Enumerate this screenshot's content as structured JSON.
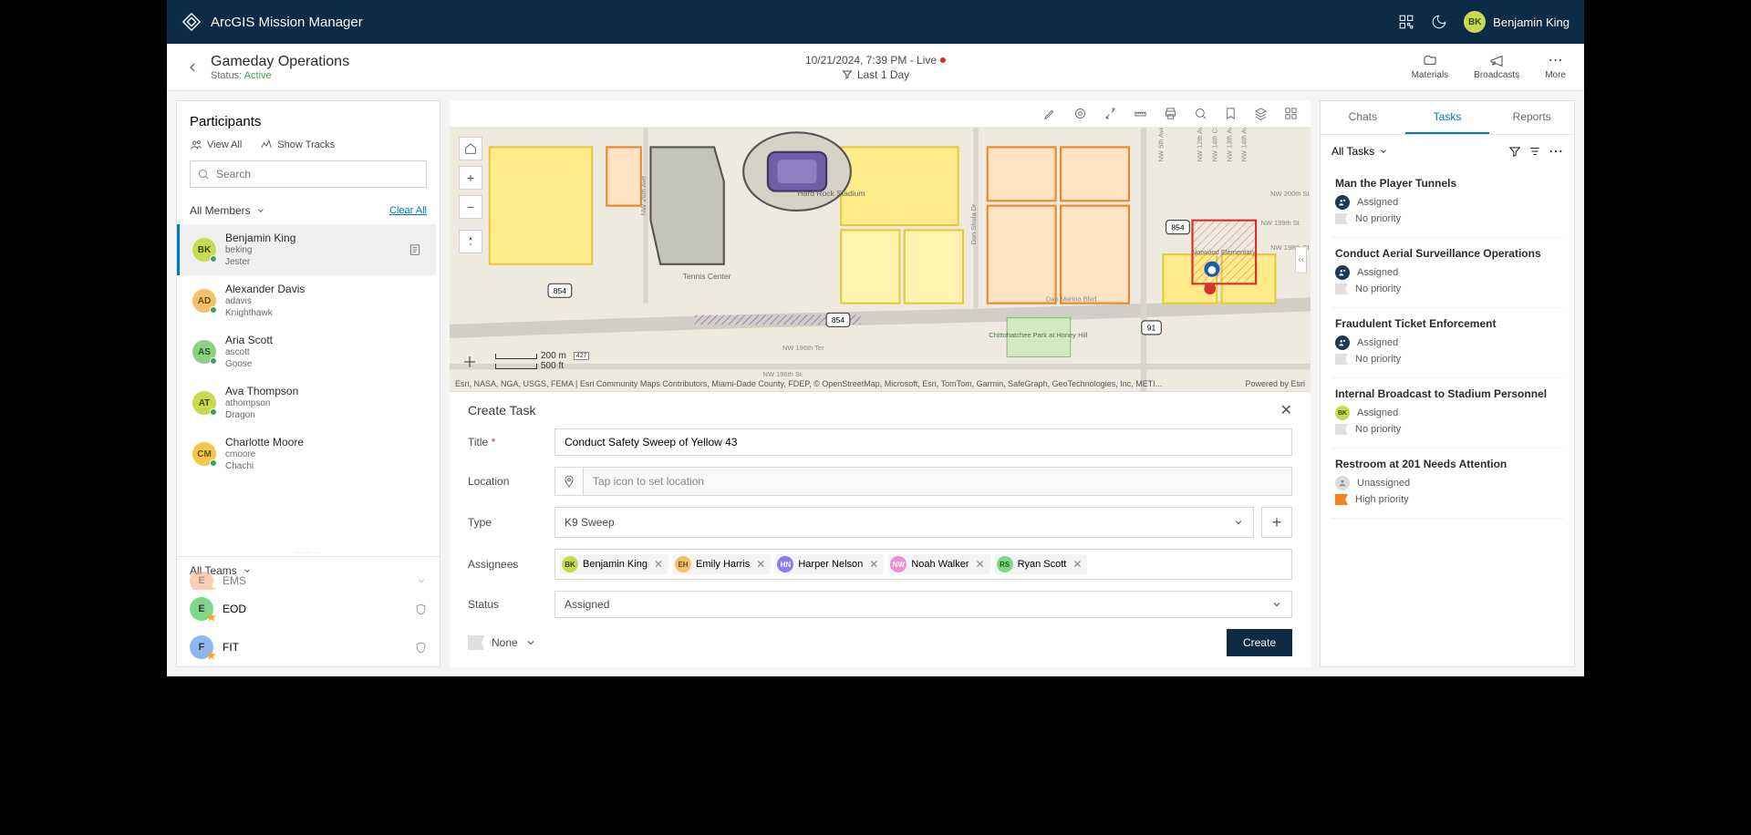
{
  "topbar": {
    "app_title": "ArcGIS Mission Manager",
    "user_initials": "BK",
    "user_name": "Benjamin King"
  },
  "subheader": {
    "mission_title": "Gameday Operations",
    "status_label": "Status:",
    "status_value": "Active",
    "datetime": "10/21/2024, 7:39 PM - Live",
    "time_filter": "Last 1 Day",
    "actions": {
      "materials": "Materials",
      "broadcasts": "Broadcasts",
      "more": "More"
    }
  },
  "participants": {
    "title": "Participants",
    "view_all": "View All",
    "show_tracks": "Show Tracks",
    "search_placeholder": "Search",
    "all_members_label": "All Members",
    "clear_all": "Clear All",
    "members": [
      {
        "initials": "BK",
        "bg": "#c8d952",
        "fg": "#3a4a00",
        "name": "Benjamin King",
        "user": "beking",
        "role": "Jester",
        "selected": true
      },
      {
        "initials": "AD",
        "bg": "#f5c26b",
        "fg": "#6b4a0f",
        "name": "Alexander Davis",
        "user": "adavis",
        "role": "Knighthawk",
        "selected": false
      },
      {
        "initials": "AS",
        "bg": "#8ed081",
        "fg": "#225b1a",
        "name": "Aria Scott",
        "user": "ascott",
        "role": "Goose",
        "selected": false
      },
      {
        "initials": "AT",
        "bg": "#c8d952",
        "fg": "#3a4a00",
        "name": "Ava Thompson",
        "user": "athompson",
        "role": "Dragon",
        "selected": false
      },
      {
        "initials": "CM",
        "bg": "#f1c84c",
        "fg": "#6b5300",
        "name": "Charlotte Moore",
        "user": "cmoore",
        "role": "Chachi",
        "selected": false
      }
    ],
    "all_teams_label": "All Teams",
    "teams": [
      {
        "initial": "E",
        "bg": "#f7a072",
        "name": "EMS",
        "partial": true
      },
      {
        "initial": "E",
        "bg": "#7fd88a",
        "name": "EOD"
      },
      {
        "initial": "F",
        "bg": "#8fb7ef",
        "name": "FIT"
      }
    ]
  },
  "map": {
    "scale_m": "200 m",
    "scale_ft": "500 ft",
    "attribution": "Esri, NASA, NGA, USGS, FEMA | Esri Community Maps Contributors, Miami-Dade County, FDEP, © OpenStreetMap, Microsoft, Esri, TomTom, Garmin, SafeGraph, GeoTechnologies, Inc, METI...",
    "powered": "Powered by Esri",
    "labels": {
      "tennis_center": "Tennis Center",
      "hard_rock": "Hard Rock Stadium",
      "park": "Chittohatchee Park at Honey Hill",
      "school": "Norwood Elementary",
      "dan_marino": "Dan Marino Blvd",
      "nw196": "NW 196th St",
      "nw196ter": "NW 196th Ter",
      "nw199": "NW 199th St",
      "nw200": "NW 200th St",
      "nw198": "NW 198th St",
      "nw26ave": "NW 26th Ave",
      "donshula": "Don Shula Dr",
      "route854a": "854",
      "route854b": "854",
      "route854c": "854",
      "route91": "91",
      "nw5ave": "NW 5th Ave",
      "nw12ave": "NW 12th Ave",
      "nw13ave": "NW 13th Ave",
      "nw14ave": "NW 14th Ave",
      "nw14ct": "NW 14th Ct",
      "route427": "427"
    }
  },
  "create_task": {
    "panel_title": "Create Task",
    "title_label": "Title",
    "title_value": "Conduct Safety Sweep of Yellow 43",
    "location_label": "Location",
    "location_placeholder": "Tap icon to set location",
    "type_label": "Type",
    "type_value": "K9 Sweep",
    "assignees_label": "Assignees",
    "assignees": [
      {
        "initials": "BK",
        "bg": "#c8d952",
        "fg": "#3a4a00",
        "name": "Benjamin King"
      },
      {
        "initials": "EH",
        "bg": "#f5c26b",
        "fg": "#6b4a0f",
        "name": "Emily Harris"
      },
      {
        "initials": "HN",
        "bg": "#8f7cf0",
        "fg": "#fff",
        "name": "Harper Nelson"
      },
      {
        "initials": "NW",
        "bg": "#f08fd6",
        "fg": "#fff",
        "name": "Noah Walker"
      },
      {
        "initials": "RS",
        "bg": "#7fd88a",
        "fg": "#225b1a",
        "name": "Ryan Scott"
      }
    ],
    "status_label": "Status",
    "status_value": "Assigned",
    "priority_value": "None",
    "create_btn": "Create"
  },
  "right_panel": {
    "tabs": {
      "chats": "Chats",
      "tasks": "Tasks",
      "reports": "Reports"
    },
    "filter_label": "All Tasks",
    "tasks": [
      {
        "title": "Man the Player Tunnels",
        "assigned_label": "Assigned",
        "assigned_type": "group",
        "priority": "No priority"
      },
      {
        "title": "Conduct Aerial Surveillance Operations",
        "assigned_label": "Assigned",
        "assigned_type": "group",
        "priority": "No priority"
      },
      {
        "title": "Fraudulent Ticket Enforcement",
        "assigned_label": "Assigned",
        "assigned_type": "group",
        "priority": "No priority"
      },
      {
        "title": "Internal Broadcast to Stadium Personnel",
        "assigned_label": "Assigned",
        "assigned_type": "bk",
        "priority": "No priority"
      },
      {
        "title": "Restroom at 201 Needs Attention",
        "assigned_label": "Unassigned",
        "assigned_type": "un",
        "priority": "High priority",
        "priority_high": true
      }
    ]
  }
}
